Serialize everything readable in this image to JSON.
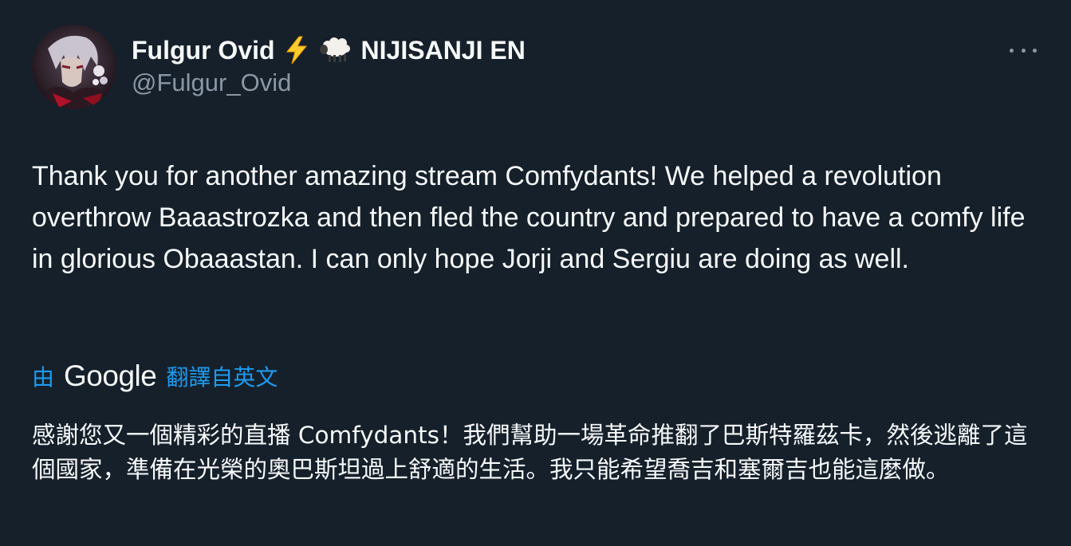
{
  "author": {
    "display_name": "Fulgur Ovid",
    "org_label": "NIJISANJI EN",
    "handle": "@Fulgur_Ovid",
    "name_emojis": [
      "lightning-bolt-icon",
      "sheep-icon"
    ]
  },
  "tweet": {
    "text": "Thank you for another amazing stream Comfydants! We helped a revolution overthrow Baaastrozka and then fled the country and prepared to have a comfy life in glorious Obaaastan. I can only hope Jorji and Sergiu are doing as well."
  },
  "translation": {
    "by_label": "由",
    "provider": "Google",
    "link_label": "翻譯自英文",
    "text": "感謝您又一個精彩的直播 Comfydants！我們幫助一場革命推翻了巴斯特羅茲卡，然後逃離了這個國家，準備在光榮的奧巴斯坦過上舒適的生活。我只能希望喬吉和塞爾吉也能這麼做。"
  },
  "menu": {
    "more_icon": "more-horizontal-icon"
  },
  "colors": {
    "background": "#15202b",
    "primary_text": "#f7f9f9",
    "secondary_text": "#8b98a5",
    "link": "#1d9bf0"
  }
}
